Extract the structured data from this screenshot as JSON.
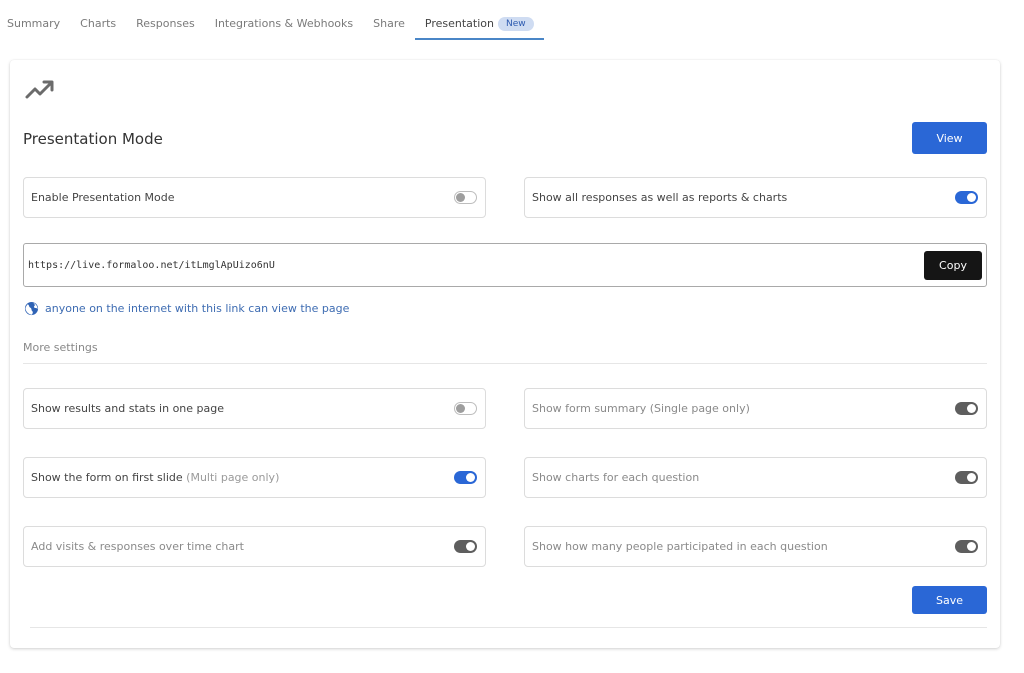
{
  "tabs": [
    {
      "label": "Summary",
      "active": false
    },
    {
      "label": "Charts",
      "active": false
    },
    {
      "label": "Responses",
      "active": false
    },
    {
      "label": "Integrations & Webhooks",
      "active": false
    },
    {
      "label": "Share",
      "active": false
    },
    {
      "label": "Presentation",
      "active": true,
      "badge": "New"
    }
  ],
  "header": {
    "icon": "trending-up-icon",
    "title": "Presentation Mode",
    "view_label": "View"
  },
  "top_settings": [
    {
      "label": "Enable Presentation Mode",
      "state": "off"
    },
    {
      "label": "Show all responses as well as reports & charts",
      "state": "on"
    }
  ],
  "share_link": {
    "url": "https://live.formaloo.net/itLmglApUizo6nU",
    "copy_label": "Copy",
    "note_icon": "globe-icon",
    "note": "anyone on the internet with this link can view the page"
  },
  "more_settings": {
    "heading": "More settings",
    "items": [
      {
        "label": "Show results and stats in one page",
        "hint": "",
        "state": "off",
        "muted": false
      },
      {
        "label": "Show form summary",
        "hint": "(Single page only)",
        "state": "on-disabled",
        "muted": true
      },
      {
        "label": "Show the form on first slide",
        "hint": "(Multi page only)",
        "state": "on",
        "muted": false
      },
      {
        "label": "Show charts for each question",
        "hint": "",
        "state": "on-disabled",
        "muted": true
      },
      {
        "label": "Add visits & responses over time chart",
        "hint": "",
        "state": "on-disabled",
        "muted": true
      },
      {
        "label": "Show how many people participated in each question",
        "hint": "",
        "state": "on-disabled",
        "muted": true
      }
    ]
  },
  "footer": {
    "save_label": "Save"
  },
  "colors": {
    "primary": "#2a67d6",
    "tab_underline": "#4a86c7",
    "badge_bg": "#cfdcf2",
    "copy_button": "#151515",
    "link_note": "#3e6cb2",
    "toggle_disabled_on": "#5e5e5e"
  }
}
